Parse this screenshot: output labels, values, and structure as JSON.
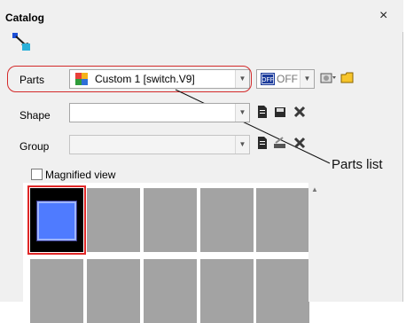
{
  "window": {
    "title": "Catalog",
    "close_glyph": "×"
  },
  "toolbar": {
    "icon": "catalog-tool-icon"
  },
  "parts": {
    "label": "Parts",
    "value": "Custom 1 [switch.V9]",
    "switch_value": "OFF"
  },
  "shape": {
    "label": "Shape",
    "value": ""
  },
  "group": {
    "label": "Group",
    "value": ""
  },
  "magnified": {
    "label": "Magnified view",
    "checked": false
  },
  "annotation": {
    "text": "Parts list"
  },
  "colors": {
    "callout": "#d42a2a",
    "selected_part": "#4f7bff",
    "thumb": "#a3a3a3"
  }
}
